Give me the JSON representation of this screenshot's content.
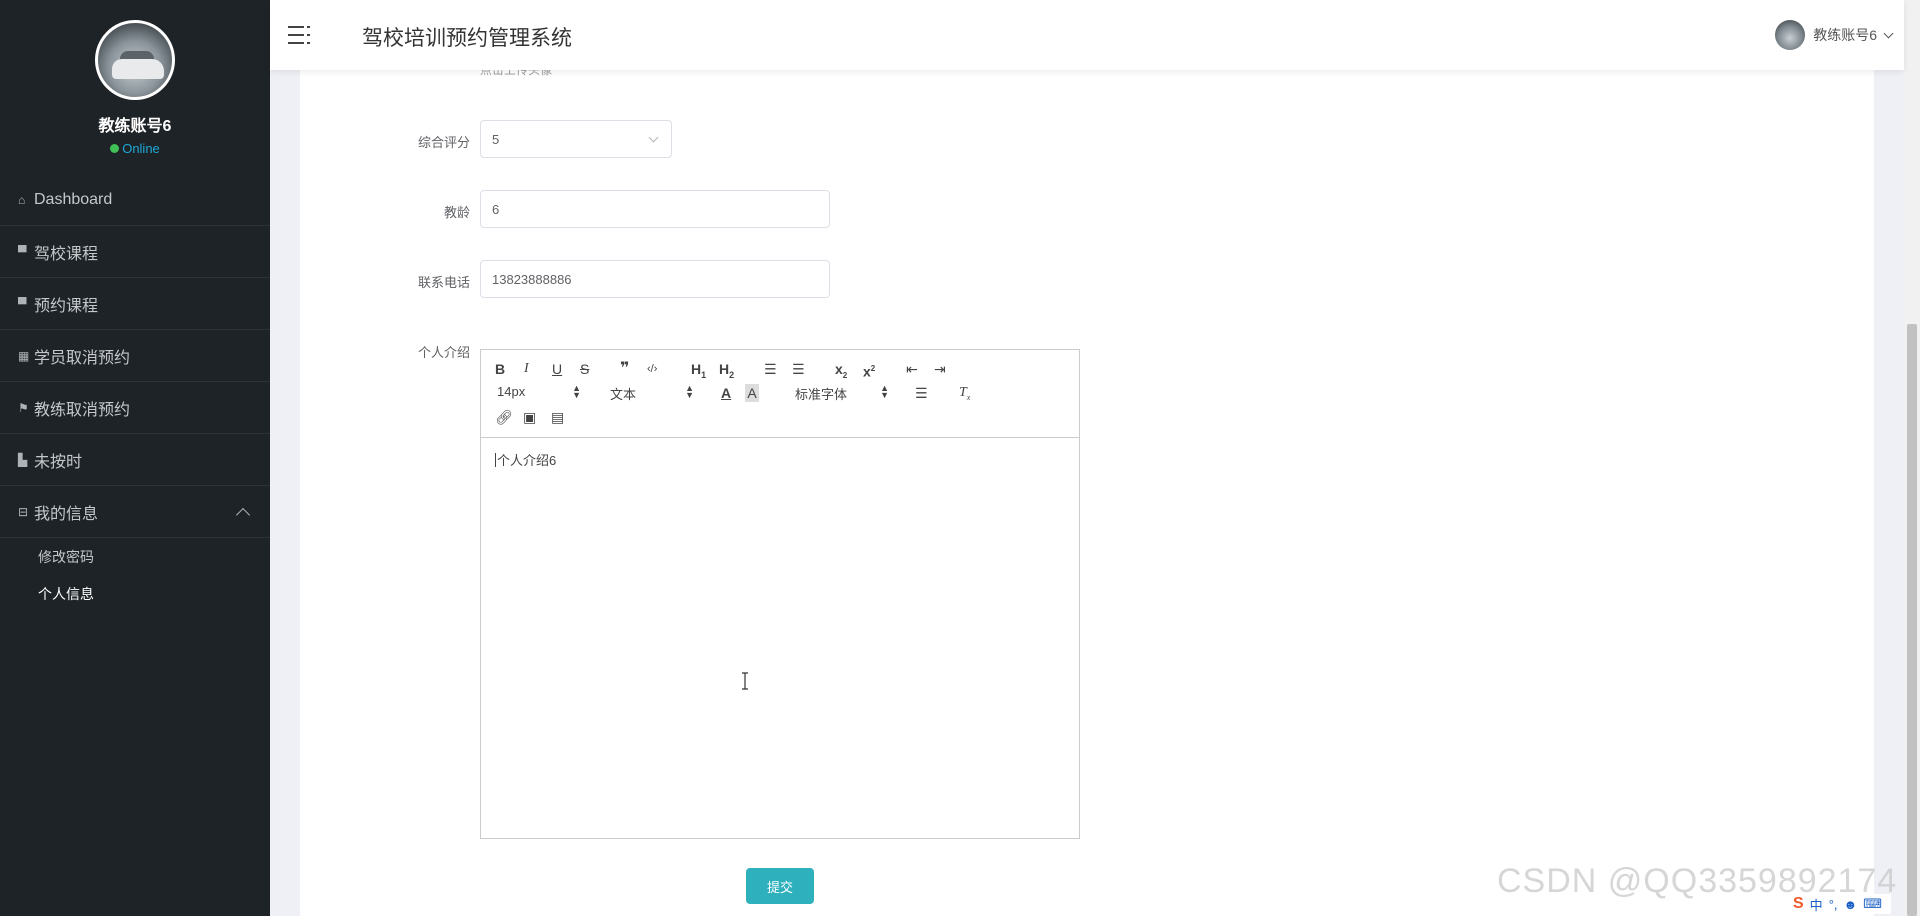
{
  "sidebar": {
    "user_name": "教练账号6",
    "status": "Online",
    "menu": [
      {
        "label": "Dashboard",
        "icon": "home-icon"
      },
      {
        "label": "驾校课程",
        "icon": "chat-icon"
      },
      {
        "label": "预约课程",
        "icon": "ticket-icon"
      },
      {
        "label": "学员取消预约",
        "icon": "grid-icon"
      },
      {
        "label": "教练取消预约",
        "icon": "flag-icon"
      },
      {
        "label": "未按时",
        "icon": "chart-icon"
      },
      {
        "label": "我的信息",
        "icon": "form-icon"
      }
    ],
    "submenu": [
      {
        "label": "修改密码"
      },
      {
        "label": "个人信息"
      }
    ]
  },
  "header": {
    "title": "驾校培训预约管理系统",
    "user": "教练账号6"
  },
  "form": {
    "upload_hint": "点击上传头像",
    "rating_label": "综合评分",
    "rating_value": "5",
    "experience_label": "教龄",
    "experience_value": "6",
    "phone_label": "联系电话",
    "phone_value": "13823888886",
    "intro_label": "个人介绍",
    "intro_value": "个人介绍6",
    "submit_label": "提交"
  },
  "editor_toolbar": {
    "font_size": "14px",
    "paragraph": "文本",
    "font_family": "标准字体"
  },
  "overlay": {
    "watermark": "CSDN @QQ3359892174",
    "ime": [
      "中",
      "°,",
      "☻",
      "⌨"
    ]
  },
  "colors": {
    "sidebar_bg": "#1e2327",
    "accent": "#2fb0bd",
    "online": "#3fbf55"
  }
}
